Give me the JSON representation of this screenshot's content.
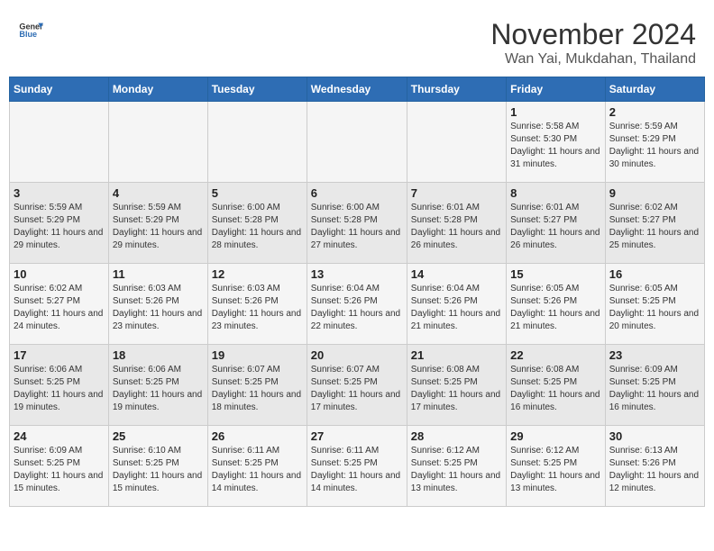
{
  "header": {
    "logo_general": "General",
    "logo_blue": "Blue",
    "month": "November 2024",
    "location": "Wan Yai, Mukdahan, Thailand"
  },
  "weekdays": [
    "Sunday",
    "Monday",
    "Tuesday",
    "Wednesday",
    "Thursday",
    "Friday",
    "Saturday"
  ],
  "weeks": [
    [
      {
        "day": "",
        "info": ""
      },
      {
        "day": "",
        "info": ""
      },
      {
        "day": "",
        "info": ""
      },
      {
        "day": "",
        "info": ""
      },
      {
        "day": "",
        "info": ""
      },
      {
        "day": "1",
        "info": "Sunrise: 5:58 AM\nSunset: 5:30 PM\nDaylight: 11 hours and 31 minutes."
      },
      {
        "day": "2",
        "info": "Sunrise: 5:59 AM\nSunset: 5:29 PM\nDaylight: 11 hours and 30 minutes."
      }
    ],
    [
      {
        "day": "3",
        "info": "Sunrise: 5:59 AM\nSunset: 5:29 PM\nDaylight: 11 hours and 29 minutes."
      },
      {
        "day": "4",
        "info": "Sunrise: 5:59 AM\nSunset: 5:29 PM\nDaylight: 11 hours and 29 minutes."
      },
      {
        "day": "5",
        "info": "Sunrise: 6:00 AM\nSunset: 5:28 PM\nDaylight: 11 hours and 28 minutes."
      },
      {
        "day": "6",
        "info": "Sunrise: 6:00 AM\nSunset: 5:28 PM\nDaylight: 11 hours and 27 minutes."
      },
      {
        "day": "7",
        "info": "Sunrise: 6:01 AM\nSunset: 5:28 PM\nDaylight: 11 hours and 26 minutes."
      },
      {
        "day": "8",
        "info": "Sunrise: 6:01 AM\nSunset: 5:27 PM\nDaylight: 11 hours and 26 minutes."
      },
      {
        "day": "9",
        "info": "Sunrise: 6:02 AM\nSunset: 5:27 PM\nDaylight: 11 hours and 25 minutes."
      }
    ],
    [
      {
        "day": "10",
        "info": "Sunrise: 6:02 AM\nSunset: 5:27 PM\nDaylight: 11 hours and 24 minutes."
      },
      {
        "day": "11",
        "info": "Sunrise: 6:03 AM\nSunset: 5:26 PM\nDaylight: 11 hours and 23 minutes."
      },
      {
        "day": "12",
        "info": "Sunrise: 6:03 AM\nSunset: 5:26 PM\nDaylight: 11 hours and 23 minutes."
      },
      {
        "day": "13",
        "info": "Sunrise: 6:04 AM\nSunset: 5:26 PM\nDaylight: 11 hours and 22 minutes."
      },
      {
        "day": "14",
        "info": "Sunrise: 6:04 AM\nSunset: 5:26 PM\nDaylight: 11 hours and 21 minutes."
      },
      {
        "day": "15",
        "info": "Sunrise: 6:05 AM\nSunset: 5:26 PM\nDaylight: 11 hours and 21 minutes."
      },
      {
        "day": "16",
        "info": "Sunrise: 6:05 AM\nSunset: 5:25 PM\nDaylight: 11 hours and 20 minutes."
      }
    ],
    [
      {
        "day": "17",
        "info": "Sunrise: 6:06 AM\nSunset: 5:25 PM\nDaylight: 11 hours and 19 minutes."
      },
      {
        "day": "18",
        "info": "Sunrise: 6:06 AM\nSunset: 5:25 PM\nDaylight: 11 hours and 19 minutes."
      },
      {
        "day": "19",
        "info": "Sunrise: 6:07 AM\nSunset: 5:25 PM\nDaylight: 11 hours and 18 minutes."
      },
      {
        "day": "20",
        "info": "Sunrise: 6:07 AM\nSunset: 5:25 PM\nDaylight: 11 hours and 17 minutes."
      },
      {
        "day": "21",
        "info": "Sunrise: 6:08 AM\nSunset: 5:25 PM\nDaylight: 11 hours and 17 minutes."
      },
      {
        "day": "22",
        "info": "Sunrise: 6:08 AM\nSunset: 5:25 PM\nDaylight: 11 hours and 16 minutes."
      },
      {
        "day": "23",
        "info": "Sunrise: 6:09 AM\nSunset: 5:25 PM\nDaylight: 11 hours and 16 minutes."
      }
    ],
    [
      {
        "day": "24",
        "info": "Sunrise: 6:09 AM\nSunset: 5:25 PM\nDaylight: 11 hours and 15 minutes."
      },
      {
        "day": "25",
        "info": "Sunrise: 6:10 AM\nSunset: 5:25 PM\nDaylight: 11 hours and 15 minutes."
      },
      {
        "day": "26",
        "info": "Sunrise: 6:11 AM\nSunset: 5:25 PM\nDaylight: 11 hours and 14 minutes."
      },
      {
        "day": "27",
        "info": "Sunrise: 6:11 AM\nSunset: 5:25 PM\nDaylight: 11 hours and 14 minutes."
      },
      {
        "day": "28",
        "info": "Sunrise: 6:12 AM\nSunset: 5:25 PM\nDaylight: 11 hours and 13 minutes."
      },
      {
        "day": "29",
        "info": "Sunrise: 6:12 AM\nSunset: 5:25 PM\nDaylight: 11 hours and 13 minutes."
      },
      {
        "day": "30",
        "info": "Sunrise: 6:13 AM\nSunset: 5:26 PM\nDaylight: 11 hours and 12 minutes."
      }
    ]
  ]
}
